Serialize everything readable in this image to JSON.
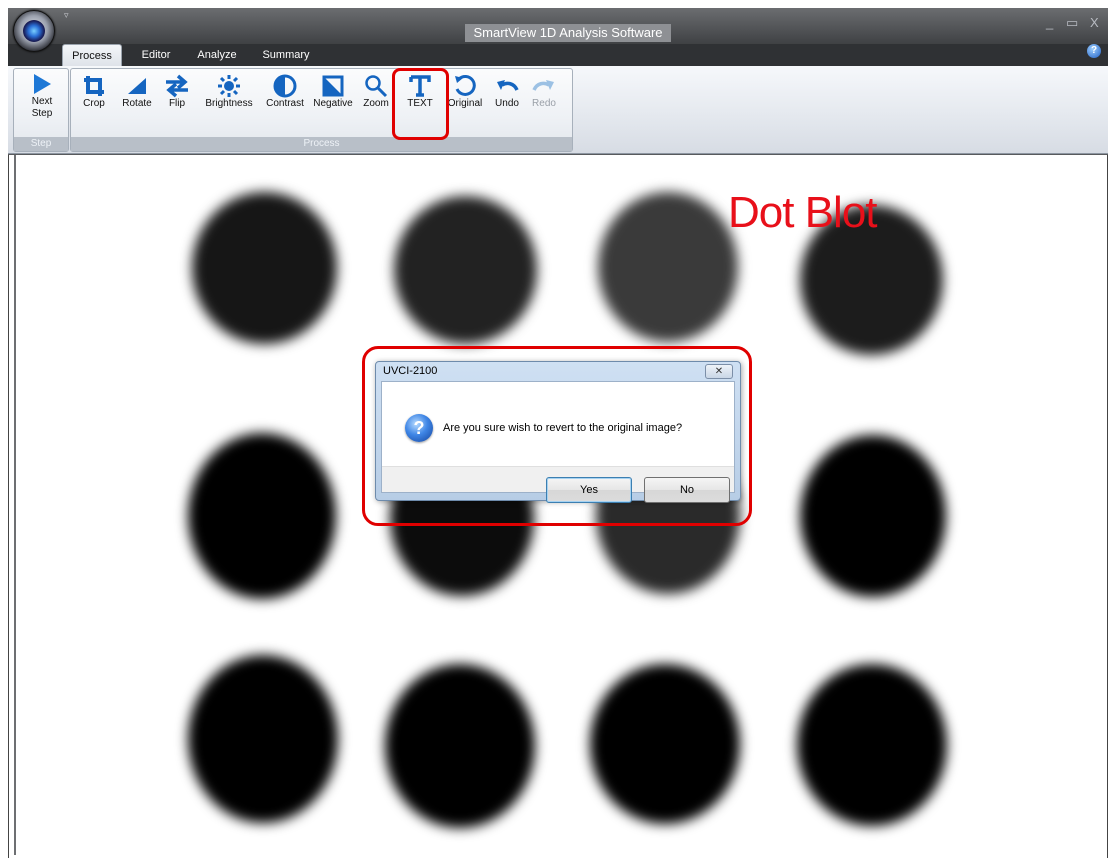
{
  "window": {
    "title": "SmartView 1D Analysis Software",
    "controls": [
      "_",
      "▭",
      "X"
    ]
  },
  "tabs": [
    {
      "label": "Process",
      "active": true
    },
    {
      "label": "Editor",
      "active": false
    },
    {
      "label": "Analyze",
      "active": false
    },
    {
      "label": "Summary",
      "active": false
    }
  ],
  "ribbon": {
    "groups": [
      {
        "label": "Step"
      },
      {
        "label": "Process"
      }
    ],
    "step_buttons": [
      {
        "label": "Next\nStep",
        "icon": "play-arrow-icon"
      }
    ],
    "process_buttons": [
      {
        "label": "Crop",
        "icon": "crop-icon",
        "enabled": true
      },
      {
        "label": "Rotate",
        "icon": "rotate-icon",
        "enabled": true
      },
      {
        "label": "Flip",
        "icon": "flip-icon",
        "enabled": true
      },
      {
        "label": "Brightness",
        "icon": "brightness-icon",
        "enabled": true
      },
      {
        "label": "Contrast",
        "icon": "contrast-icon",
        "enabled": true
      },
      {
        "label": "Negative",
        "icon": "negative-icon",
        "enabled": true
      },
      {
        "label": "Zoom",
        "icon": "zoom-icon",
        "enabled": true
      },
      {
        "label": "TEXT",
        "icon": "text-icon",
        "enabled": true
      },
      {
        "label": "Original",
        "icon": "original-icon",
        "enabled": true
      },
      {
        "label": "Undo",
        "icon": "undo-icon",
        "enabled": true
      },
      {
        "label": "Redo",
        "icon": "redo-icon",
        "enabled": false
      }
    ]
  },
  "image": {
    "annotation": "Dot Blot",
    "annotation_color": "#e8101a"
  },
  "dialog": {
    "title": "UVCI-2100",
    "message": "Are you sure wish to revert to the original image?",
    "icon": "question-icon",
    "yes_label": "Yes",
    "no_label": "No"
  },
  "colors": {
    "highlight": "#e00000",
    "accent": "#1f5fc4"
  }
}
